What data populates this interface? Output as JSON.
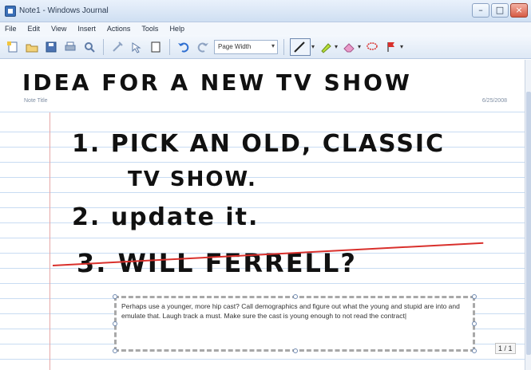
{
  "window": {
    "title": "Note1 - Windows Journal",
    "minimize_glyph": "–",
    "maximize_glyph": "□",
    "close_glyph": "×"
  },
  "menu": {
    "items": [
      "File",
      "Edit",
      "View",
      "Insert",
      "Actions",
      "Tools",
      "Help"
    ]
  },
  "toolbar": {
    "zoom_value": "Page Width",
    "icons": [
      "new-note-icon",
      "open-icon",
      "save-icon",
      "print-icon",
      "search-icon",
      "insert-space-icon",
      "select-icon",
      "page-icon",
      "undo-icon",
      "redo-icon",
      "pen-icon",
      "highlighter-icon",
      "eraser-icon",
      "lasso-icon",
      "flag-icon"
    ]
  },
  "page": {
    "title_ink": "IDEA FOR A NEW TV SHOW",
    "small_label": "Note Title",
    "small_date": "6/25/2008",
    "ink_lines": [
      "1. PICK AN OLD, CLASSIC",
      "TV SHOW.",
      "2. update it.",
      "3. WILL FERRELL?"
    ],
    "textbox": "Perhaps use a younger, more hip cast? Call demographics and figure out what the young and stupid are into and emulate that. Laugh track a must. Make sure the cast is young enough to not read the contract|",
    "page_counter": "1 / 1"
  },
  "colors": {
    "accent": "#3a6fb8",
    "rule_line": "#c8dcf2",
    "margin_line": "#e6a7a7",
    "strike": "#d9302c"
  }
}
